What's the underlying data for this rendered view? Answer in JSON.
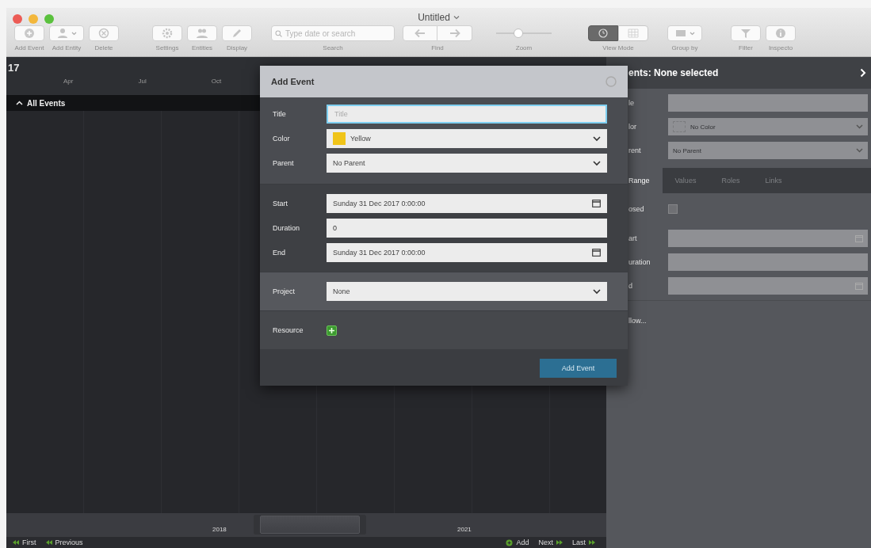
{
  "window": {
    "title": "Untitled"
  },
  "toolbar": [
    [
      {
        "kind": "button",
        "label": "Add Event"
      },
      {
        "kind": "menu",
        "label": "Add Entity"
      },
      {
        "kind": "button",
        "label": "Delete"
      }
    ],
    [
      {
        "kind": "button",
        "label": "Settings"
      },
      {
        "kind": "button",
        "label": "Entities"
      },
      {
        "kind": "button",
        "label": "Display"
      }
    ],
    [
      {
        "kind": "search",
        "label": "Search",
        "placeholder": "Type date or search"
      }
    ],
    [
      {
        "kind": "pair",
        "label": "Find"
      }
    ],
    [
      {
        "kind": "slider",
        "label": "Zoom",
        "level": 0.4
      }
    ],
    [
      {
        "kind": "segmented",
        "label": "View Mode",
        "segments": [
          {
            "selected": true
          },
          {
            "selected": false
          }
        ]
      }
    ],
    [
      {
        "kind": "menu",
        "label": "Group by"
      }
    ],
    [
      {
        "kind": "button",
        "label": "Filter"
      },
      {
        "kind": "button",
        "label": "Inspecto"
      }
    ]
  ],
  "timeline": {
    "year": "17",
    "months": [
      "Apr",
      "Jul",
      "Oct"
    ],
    "group": {
      "label": "All Events",
      "expanded": true
    },
    "axis_years": [
      "2018",
      "2021"
    ],
    "nav_left": [
      "First",
      "Previous"
    ],
    "nav_right": [
      "Add",
      "Next",
      "Last"
    ]
  },
  "dialog": {
    "title": "Add Event",
    "sections": [
      {
        "rows": [
          {
            "kind": "text",
            "label": "Title",
            "placeholder": "Title",
            "focused": true
          },
          {
            "kind": "color",
            "label": "Color",
            "value": "Yellow",
            "color": "#f0c419"
          },
          {
            "kind": "select",
            "label": "Parent",
            "value": "No Parent"
          }
        ]
      },
      {
        "rows": [
          {
            "kind": "date",
            "label": "Start",
            "value": "Sunday 31 Dec 2017 0:00:00"
          },
          {
            "kind": "text",
            "label": "Duration",
            "value": "0",
            "focused": false
          },
          {
            "kind": "date",
            "label": "End",
            "value": "Sunday 31 Dec 2017 0:00:00"
          }
        ]
      },
      {
        "rows": [
          {
            "kind": "select",
            "label": "Project",
            "value": "None"
          }
        ]
      },
      {
        "rows": [
          {
            "kind": "add",
            "label": "Resource"
          }
        ]
      }
    ],
    "button": "Add Event"
  },
  "inspector": {
    "title": "ents: None selected",
    "fields": [
      {
        "kind": "text",
        "label": "le"
      },
      {
        "kind": "color",
        "label": "lor",
        "value": "No Color"
      },
      {
        "kind": "select",
        "label": "rent",
        "value": "No Parent"
      }
    ],
    "tabs": [
      {
        "label": "Range",
        "selected": true
      },
      {
        "label": "Values",
        "selected": false
      },
      {
        "label": "Roles",
        "selected": false
      },
      {
        "label": "Links",
        "selected": false
      }
    ],
    "proposed": {
      "label": "osed",
      "checked": false
    },
    "range_fields": [
      {
        "kind": "date",
        "label": "art"
      },
      {
        "kind": "text",
        "label": "uration"
      },
      {
        "kind": "date",
        "label": "d"
      }
    ],
    "link": "llow..."
  }
}
